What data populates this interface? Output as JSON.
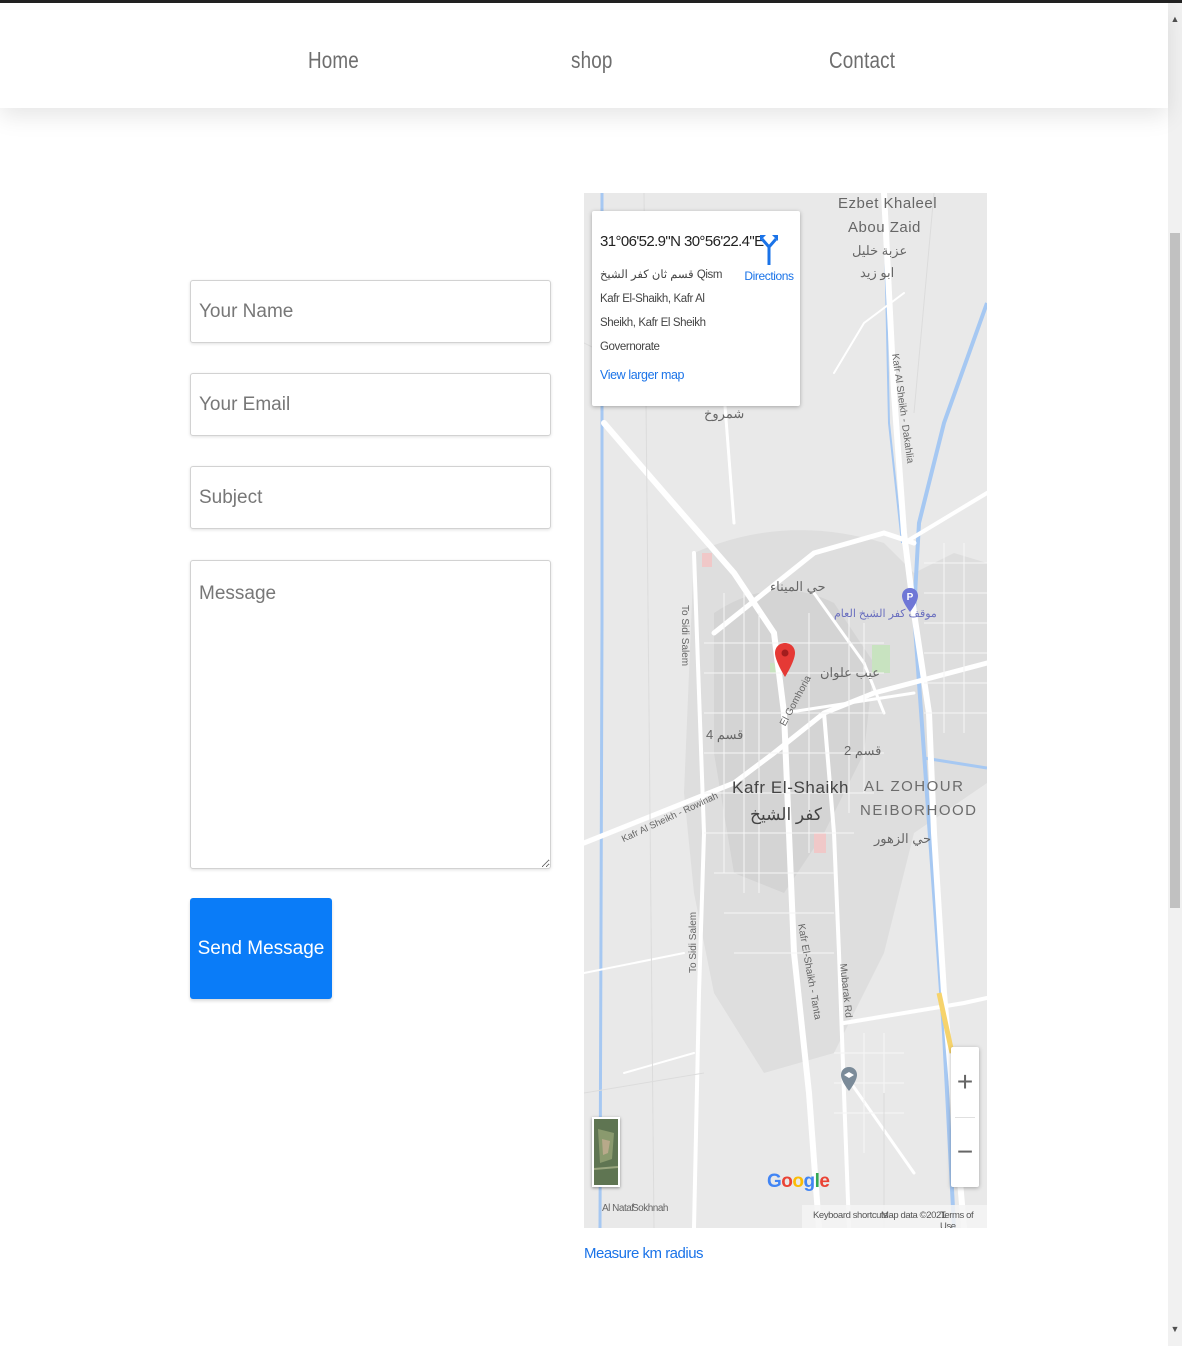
{
  "nav": {
    "links": [
      "Home",
      "shop",
      "Contact"
    ]
  },
  "form": {
    "name_placeholder": "Your Name",
    "email_placeholder": "Your Email",
    "subject_placeholder": "Subject",
    "message_placeholder": "Message",
    "send_label": "Send Message"
  },
  "map": {
    "coords": "31°06'52.9\"N 30°56'22.4\"E",
    "address": "قسم ثان كفر الشيخ Qism Kafr El-Shaikh, Kafr Al Sheikh, Kafr El Sheikh Governorate",
    "directions_label": "Directions",
    "view_larger": "View larger map",
    "labels": {
      "ezbet": "Ezbet Khaleel",
      "abou_zaid": "Abou Zaid",
      "ezbet_ar": "عزبة خليل",
      "abou_zaid_ar": "ابو زيد",
      "shamroukh": "شمروخ",
      "hay_mina": "حي الميناء",
      "mawqaf": "موقف كفر الشيخ العام",
      "alwan": "عيب علوان",
      "qism4": "قسم 4",
      "qism2": "قسم 2",
      "el_gomhoria": "El Gomhoria",
      "kafr": "Kafr El-Shaikh",
      "kafr_ar": "كفر الشيخ",
      "al_zohour": "AL ZOHOUR",
      "neighborhood": "NEIBORHOOD",
      "hay_zohour": "حي الزهور",
      "to_sidi_salem": "To Sidi Salem",
      "kafr_rowinah": "Kafr Al Sheikh - Rowinah",
      "kafr_dakahlia": "Kafr Al Sheikh - Dakahlia",
      "kafr_tanta": "Kafr El-Shaikh - Tanta",
      "mubarak": "Mubarak Rd",
      "al_nataf": "Al Nataf",
      "sokhnah": "Sokhnah"
    },
    "google": "Google",
    "keyboard_shortcuts": "Keyboard shortcuts",
    "map_data": "Map data ©2021",
    "terms": "Terms of Use",
    "zoom_in": "+",
    "zoom_out": "−"
  },
  "measure_link": "Measure km radius",
  "colors": {
    "button": "#0a7cf8",
    "link": "#1a73e8",
    "pin": "#e53935"
  },
  "icons": [
    "directions-icon",
    "map-pin-icon",
    "parking-icon",
    "school-icon"
  ]
}
